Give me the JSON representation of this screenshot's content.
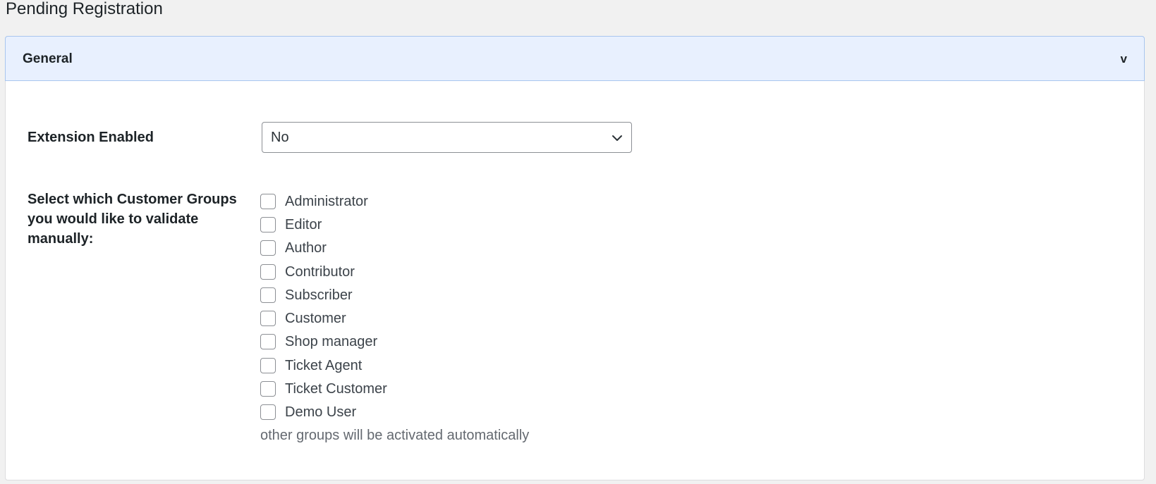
{
  "page": {
    "title": "Pending Registration"
  },
  "panel": {
    "title": "General",
    "toggle_label": "v",
    "header_bg": "#e8f0fe",
    "header_border": "#a9c6ef"
  },
  "extension_enabled": {
    "label": "Extension Enabled",
    "selected_value": "No",
    "icon": "chevron-down-icon"
  },
  "customer_groups": {
    "label": "Select which Customer Groups you would like to validate manually:",
    "groups": [
      {
        "label": "Administrator",
        "checked": false
      },
      {
        "label": "Editor",
        "checked": false
      },
      {
        "label": "Author",
        "checked": false
      },
      {
        "label": "Contributor",
        "checked": false
      },
      {
        "label": "Subscriber",
        "checked": false
      },
      {
        "label": "Customer",
        "checked": false
      },
      {
        "label": "Shop manager",
        "checked": false
      },
      {
        "label": "Ticket Agent",
        "checked": false
      },
      {
        "label": "Ticket Customer",
        "checked": false
      },
      {
        "label": "Demo User",
        "checked": false
      }
    ],
    "help_text": "other groups will be activated automatically"
  }
}
